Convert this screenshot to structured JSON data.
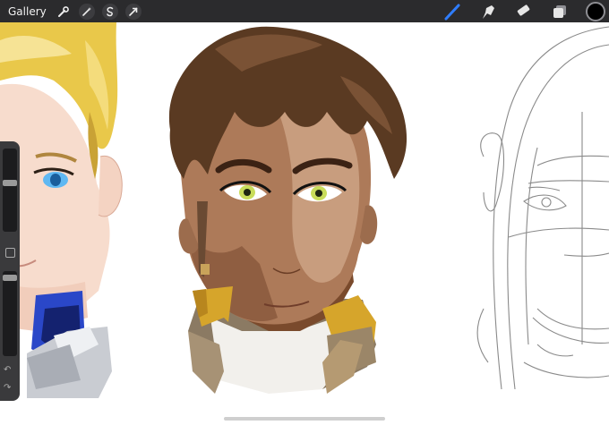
{
  "toolbar": {
    "gallery_label": "Gallery",
    "left_icons": [
      "wrench-icon",
      "magic-wand-icon",
      "selection-icon",
      "transform-arrow-icon"
    ],
    "right_tools": [
      "brush-icon",
      "smudge-icon",
      "eraser-icon",
      "layers-icon"
    ],
    "active_tool": "brush",
    "accent_color": "#2f7dff",
    "current_color": "#000000"
  },
  "sidebar": {
    "brush_size_level": 0.25,
    "opacity_level": 0.05,
    "controls": [
      "brush-size-slider",
      "modify-button",
      "opacity-slider",
      "undo-icon",
      "redo-icon"
    ]
  },
  "canvas": {
    "content": "character-portraits"
  }
}
